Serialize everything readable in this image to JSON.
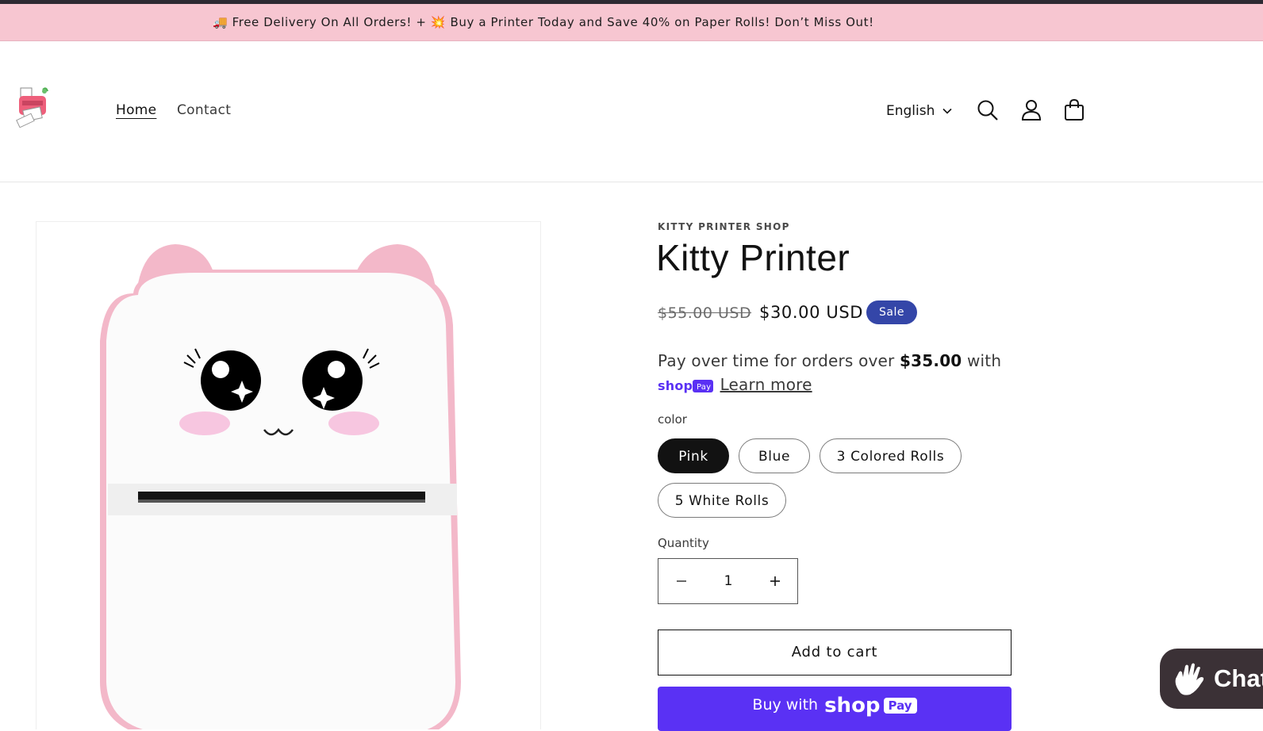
{
  "announcement": {
    "text": "🚚 Free Delivery On All Orders! + 💥 Buy a Printer Today and Save 40% on Paper Rolls! Don’t Miss Out!"
  },
  "header": {
    "nav": [
      {
        "label": "Home",
        "active": true
      },
      {
        "label": "Contact",
        "active": false
      }
    ],
    "language": "English",
    "icons": [
      "search-icon",
      "account-icon",
      "cart-icon"
    ]
  },
  "product": {
    "vendor": "KITTY PRINTER SHOP",
    "title": "Kitty Printer",
    "price_original": "$55.00 USD",
    "price_sale": "$30.00 USD",
    "badge": "Sale",
    "installments": {
      "prefix": "Pay over time for orders over ",
      "amount": "$35.00",
      "suffix": " with",
      "learn_more": "Learn more"
    },
    "color_label": "color",
    "color_options": [
      "Pink",
      "Blue",
      "3 Colored Rolls",
      "5 White Rolls"
    ],
    "selected_color": "Pink",
    "quantity_label": "Quantity",
    "quantity_value": "1",
    "add_to_cart": "Add to cart",
    "buy_now_prefix": "Buy with",
    "buy_now_brand": "shop",
    "buy_now_pay": "Pay"
  },
  "chat": {
    "label": "Chat"
  },
  "colors": {
    "announcement_bg": "#f7c6d1",
    "sale_badge": "#3446a8",
    "shop_pay": "#5a31f4",
    "chat_bg": "#3b3136",
    "printer_pink": "#f3b8c9"
  }
}
